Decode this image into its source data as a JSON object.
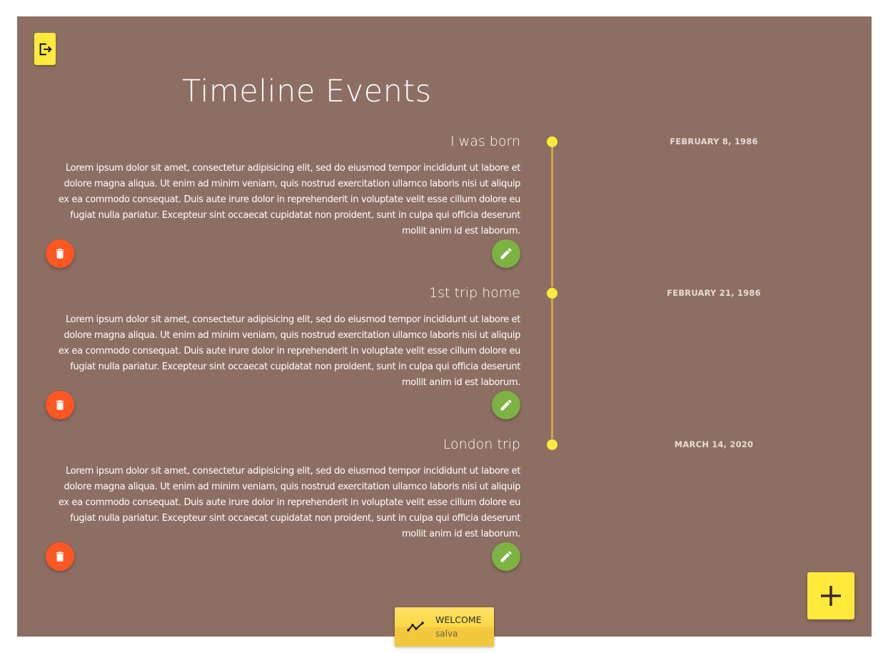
{
  "page": {
    "title": "Timeline Events"
  },
  "icons": {
    "logout": "logout-icon",
    "delete": "trash-icon",
    "edit": "pencil-icon",
    "add": "plus-icon",
    "welcome": "trend-line-icon"
  },
  "colors": {
    "background": "#8d6e63",
    "accent": "#ffeb3b",
    "delete": "#ff5722",
    "edit": "#7cb342",
    "timeline": "#c9a94c"
  },
  "events": [
    {
      "title": "I was born",
      "date": "FEBRUARY 8, 1986",
      "body": "Lorem ipsum dolor sit amet, consectetur adipisicing elit, sed do eiusmod tempor incididunt ut labore et dolore magna aliqua. Ut enim ad minim veniam, quis nostrud exercitation ullamco laboris nisi ut aliquip ex ea commodo consequat. Duis aute irure dolor in reprehenderit in voluptate velit esse cillum dolore eu fugiat nulla pariatur. Excepteur sint occaecat cupidatat non proident, sunt in culpa qui officia deserunt mollit anim id est laborum."
    },
    {
      "title": "1st trip home",
      "date": "FEBRUARY 21, 1986",
      "body": "Lorem ipsum dolor sit amet, consectetur adipisicing elit, sed do eiusmod tempor incididunt ut labore et dolore magna aliqua. Ut enim ad minim veniam, quis nostrud exercitation ullamco laboris nisi ut aliquip ex ea commodo consequat. Duis aute irure dolor in reprehenderit in voluptate velit esse cillum dolore eu fugiat nulla pariatur. Excepteur sint occaecat cupidatat non proident, sunt in culpa qui officia deserunt mollit anim id est laborum."
    },
    {
      "title": "London trip",
      "date": "MARCH 14, 2020",
      "body": "Lorem ipsum dolor sit amet, consectetur adipisicing elit, sed do eiusmod tempor incididunt ut labore et dolore magna aliqua. Ut enim ad minim veniam, quis nostrud exercitation ullamco laboris nisi ut aliquip ex ea commodo consequat. Duis aute irure dolor in reprehenderit in voluptate velit esse cillum dolore eu fugiat nulla pariatur. Excepteur sint occaecat cupidatat non proident, sunt in culpa qui officia deserunt mollit anim id est laborum."
    }
  ],
  "welcome": {
    "label": "WELCOME",
    "user": "salva"
  }
}
